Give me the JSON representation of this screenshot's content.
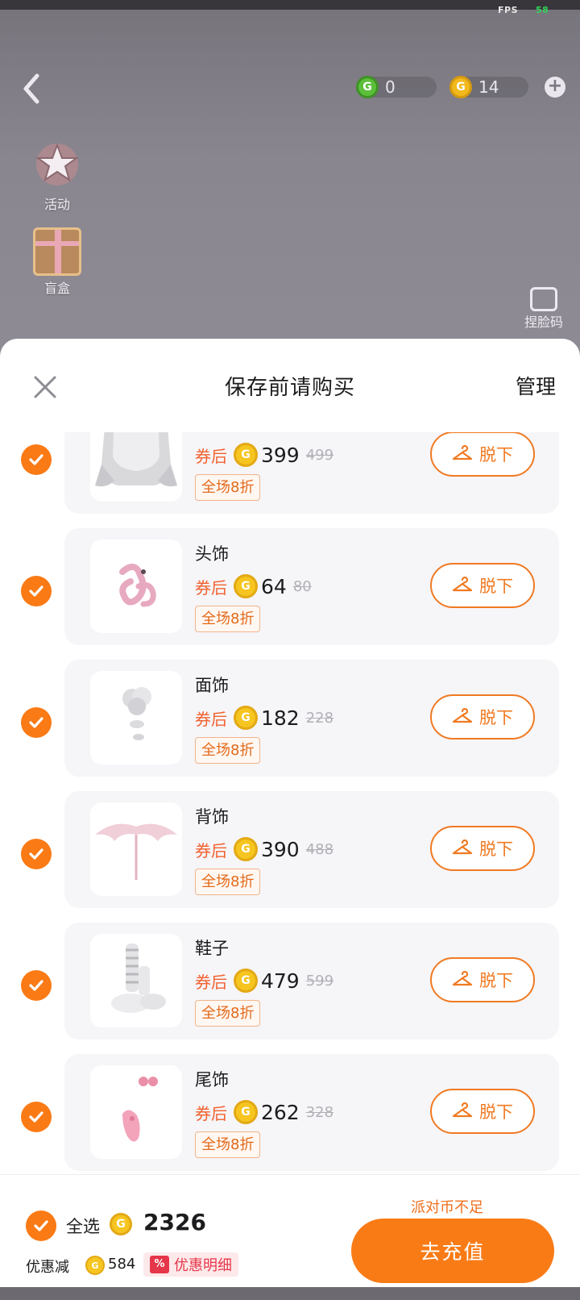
{
  "status": {
    "fps_label": "FPS",
    "fps_value": "58"
  },
  "game": {
    "currency_green": {
      "icon": "g-coin-green-icon",
      "value": "0"
    },
    "currency_gold": {
      "icon": "g-coin-gold-icon",
      "value": "14"
    },
    "side_menu": [
      {
        "label": "活动",
        "icon": "star-icon"
      },
      {
        "label": "盲盒",
        "icon": "gift-box-icon"
      }
    ],
    "face_code_label": "捏脸码"
  },
  "sheet": {
    "title": "保存前请购买",
    "manage_label": "管理",
    "items": [
      {
        "name": "",
        "coupon_label": "券后",
        "price": "399",
        "original": "499",
        "discount": "全场8折",
        "remove_label": "脱下",
        "thumb": "hair-icon"
      },
      {
        "name": "头饰",
        "coupon_label": "券后",
        "price": "64",
        "original": "80",
        "discount": "全场8折",
        "remove_label": "脱下",
        "thumb": "headwear-icon"
      },
      {
        "name": "面饰",
        "coupon_label": "券后",
        "price": "182",
        "original": "228",
        "discount": "全场8折",
        "remove_label": "脱下",
        "thumb": "face-accessory-icon"
      },
      {
        "name": "背饰",
        "coupon_label": "券后",
        "price": "390",
        "original": "488",
        "discount": "全场8折",
        "remove_label": "脱下",
        "thumb": "wings-icon"
      },
      {
        "name": "鞋子",
        "coupon_label": "券后",
        "price": "479",
        "original": "599",
        "discount": "全场8折",
        "remove_label": "脱下",
        "thumb": "shoes-icon"
      },
      {
        "name": "尾饰",
        "coupon_label": "券后",
        "price": "262",
        "original": "328",
        "discount": "全场8折",
        "remove_label": "脱下",
        "thumb": "tail-icon"
      }
    ]
  },
  "footer": {
    "select_all_label": "全选",
    "total": "2326",
    "saved_label": "优惠减",
    "saved_value": "584",
    "discount_detail_label": "优惠明细",
    "insufficient_label": "派对币不足",
    "recharge_label": "去充值"
  },
  "colors": {
    "accent": "#fa7a15",
    "discount_red": "#e5364a",
    "coin_gold": "#f6c520"
  }
}
